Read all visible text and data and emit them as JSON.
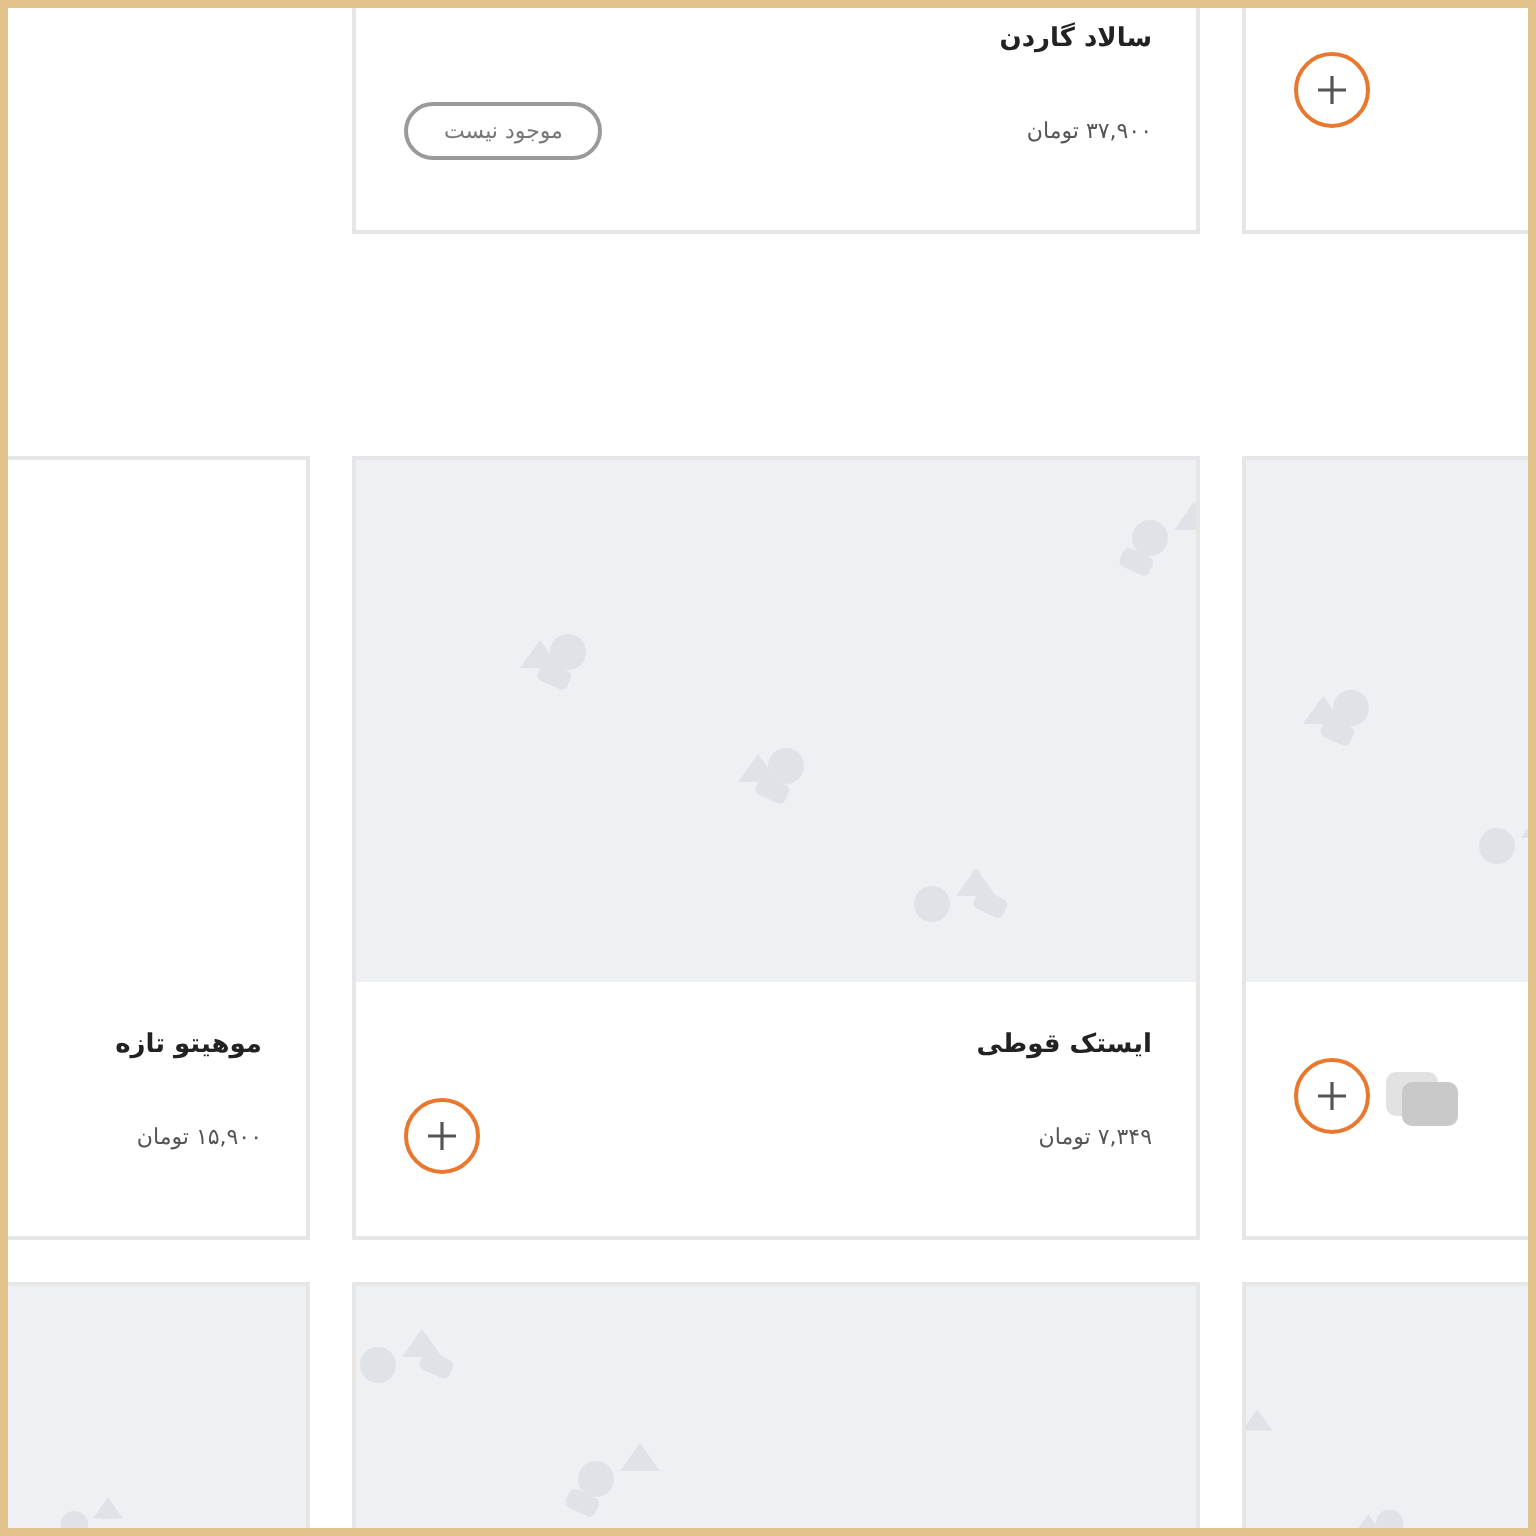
{
  "rows": [
    {
      "cards": [
        {
          "action": {
            "kind": "add"
          },
          "gallery_icon": false
        },
        {
          "name": "سالاد گاردن",
          "price": "۳۷,۹۰۰ تومان",
          "action": {
            "kind": "badge",
            "label": "موجود نیست"
          },
          "gallery_icon": false
        }
      ]
    },
    {
      "cards": [
        {
          "picture": true,
          "action": {
            "kind": "add"
          },
          "gallery_icon": true
        },
        {
          "picture": true,
          "name": "ایستک قوطی",
          "price": "۷,۳۴۹ تومان",
          "action": {
            "kind": "add"
          },
          "gallery_icon": false
        },
        {
          "picture": false,
          "name": "موهیتو تازه",
          "price": "۱۵,۹۰۰ تومان",
          "gallery_icon": false
        }
      ]
    },
    {
      "cards": [
        {
          "picture": true
        },
        {
          "picture": true
        },
        {
          "picture": true
        }
      ]
    }
  ]
}
